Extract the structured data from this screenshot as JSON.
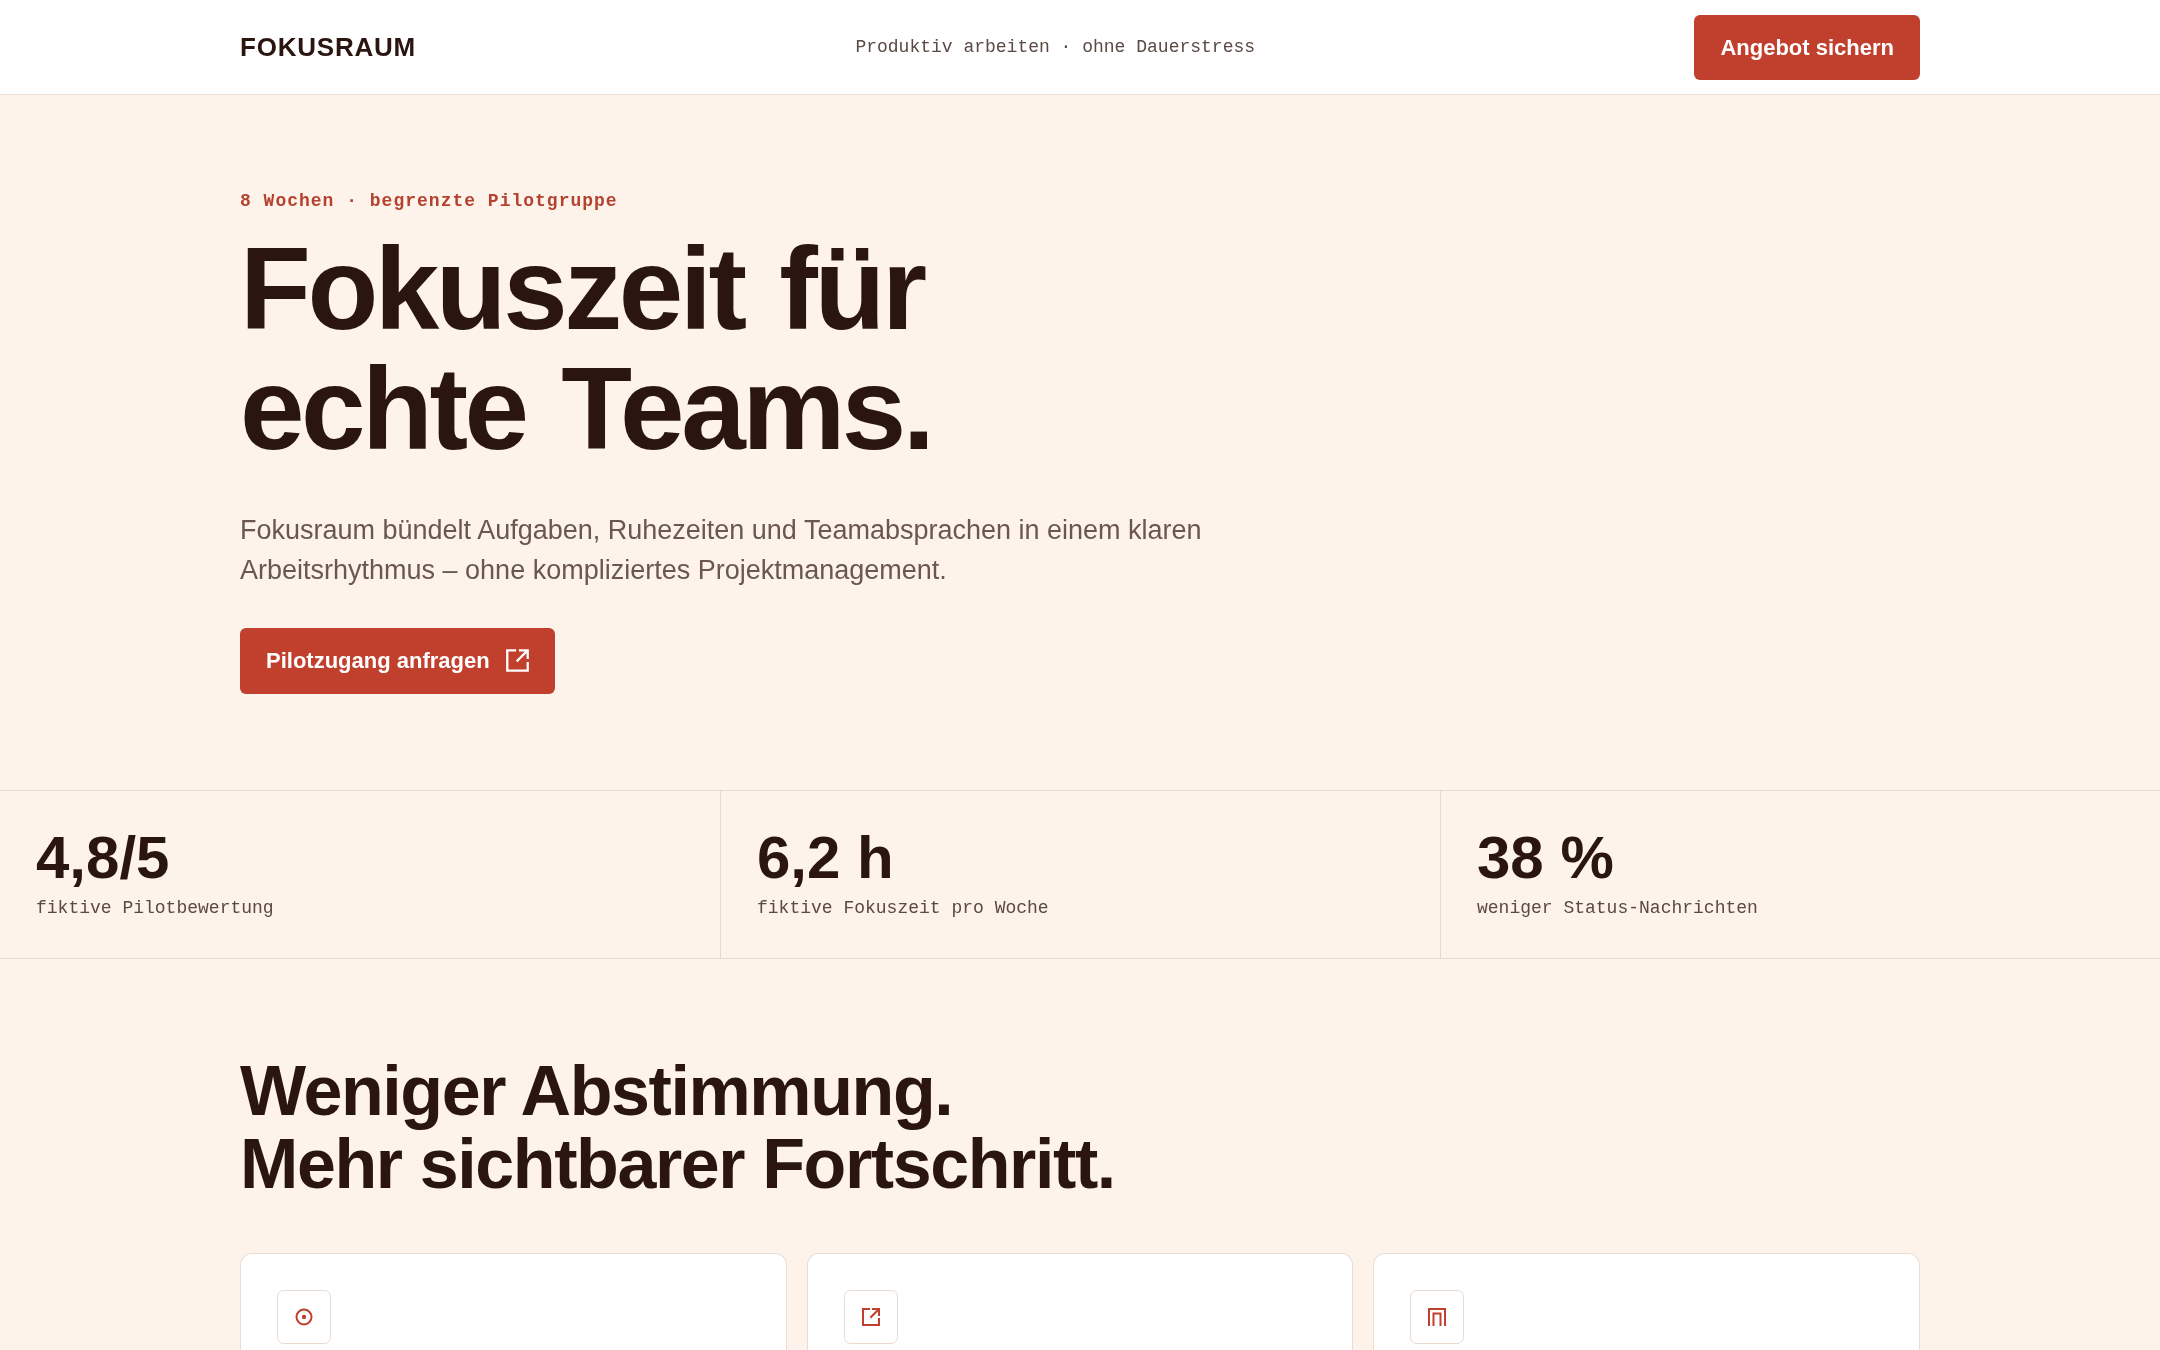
{
  "header": {
    "logo": "FOKUSRAUM",
    "tagline": "Produktiv arbeiten · ohne Dauerstress",
    "cta_button": "Angebot sichern"
  },
  "hero": {
    "eyebrow": "8 Wochen · begrenzte Pilotgruppe",
    "title_lines": [
      "Fokuszeit für",
      "echte Teams."
    ],
    "lead": "Fokusraum bündelt Aufgaben, Ruhezeiten und Teamabsprachen in einem klaren Arbeitsrhythmus – ohne kompliziertes Projektmanagement.",
    "button": {
      "label": "Pilotzugang anfragen"
    }
  },
  "stats": [
    {
      "value": "4,8/5",
      "label": "fiktive Pilotbewertung"
    },
    {
      "value": "6,2 h",
      "label": "fiktive Fokuszeit pro Woche"
    },
    {
      "value": "38 %",
      "label": "weniger Status-Nachrichten"
    }
  ],
  "features": {
    "title_lines": [
      "Weniger Abstimmung.",
      "Mehr sichtbarer Fortschritt."
    ],
    "cards": [
      {
        "kind": "target"
      },
      {
        "kind": "external"
      },
      {
        "kind": "arch"
      }
    ]
  }
}
